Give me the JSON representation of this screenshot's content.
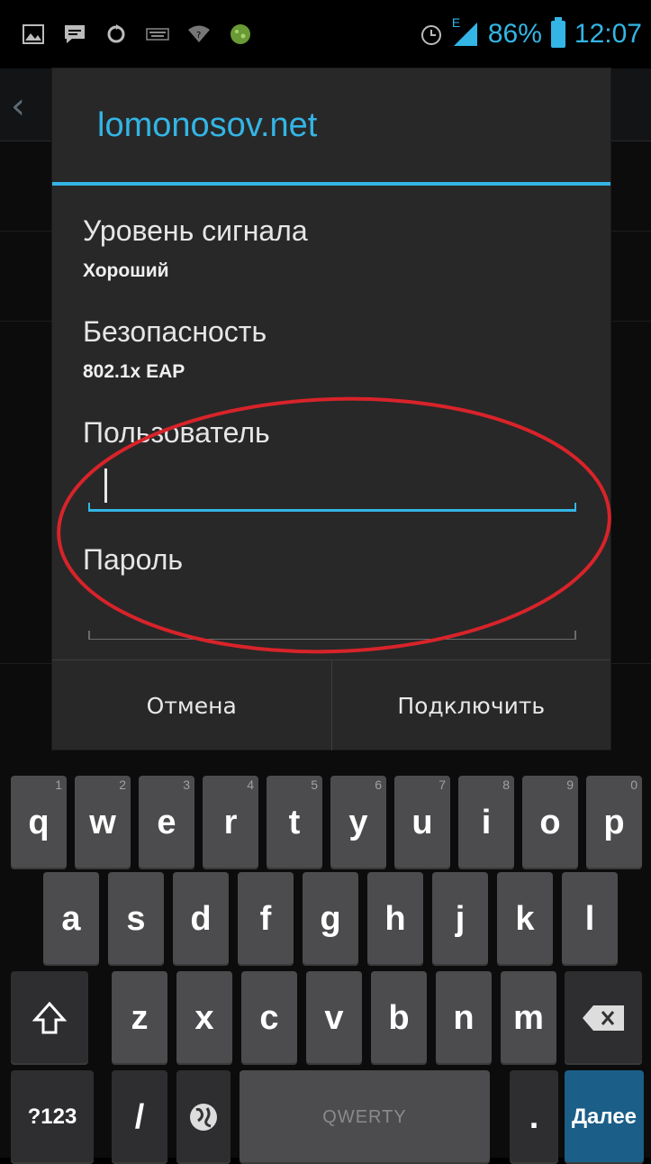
{
  "status_bar": {
    "battery_percent": "86%",
    "time": "12:07",
    "network_type": "E",
    "icons": [
      "gallery-icon",
      "message-icon",
      "sync-icon",
      "keyboard-icon",
      "wifi-question-icon",
      "android-app-icon",
      "alarm-icon",
      "signal-icon",
      "battery-icon"
    ]
  },
  "dialog": {
    "title": "lomonosov.net",
    "signal_label": "Уровень сигнала",
    "signal_value": "Хороший",
    "security_label": "Безопасность",
    "security_value": "802.1x EAP",
    "user_label": "Пользователь",
    "user_value": "",
    "password_label": "Пароль",
    "password_value": "",
    "cancel_label": "Отмена",
    "connect_label": "Подключить"
  },
  "keyboard": {
    "row1": [
      {
        "key": "q",
        "hint": "1"
      },
      {
        "key": "w",
        "hint": "2"
      },
      {
        "key": "e",
        "hint": "3"
      },
      {
        "key": "r",
        "hint": "4"
      },
      {
        "key": "t",
        "hint": "5"
      },
      {
        "key": "y",
        "hint": "6"
      },
      {
        "key": "u",
        "hint": "7"
      },
      {
        "key": "i",
        "hint": "8"
      },
      {
        "key": "o",
        "hint": "9"
      },
      {
        "key": "p",
        "hint": "0"
      }
    ],
    "row2": [
      "a",
      "s",
      "d",
      "f",
      "g",
      "h",
      "j",
      "k",
      "l"
    ],
    "row3": [
      "z",
      "x",
      "c",
      "v",
      "b",
      "n",
      "m"
    ],
    "symbols_label": "?123",
    "slash_label": "/",
    "space_label": "QWERTY",
    "period_label": ".",
    "next_label": "Далее"
  },
  "colors": {
    "accent": "#33b5e5",
    "highlight_ellipse": "#d8232a"
  }
}
